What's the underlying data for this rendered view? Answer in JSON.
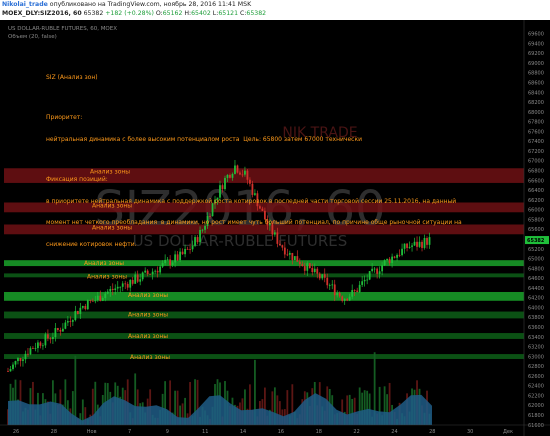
{
  "header": {
    "author": "Nikolai_trade",
    "published": "опубликовано на TradingView.com, ноябрь 28, 2016 11:41 MSK",
    "symbol": "MOEX_DLY:SIZ2016, 60",
    "last": "65382",
    "change": "+182 (+0.28%)",
    "ohlc_label_o": "O:",
    "ohlc_o": "65162",
    "ohlc_label_h": "H:",
    "ohlc_h": "65402",
    "ohlc_label_l": "L:",
    "ohlc_l": "65121",
    "ohlc_label_c": "C:",
    "ohlc_c": "65382"
  },
  "chart_header": {
    "title": "US DOLLAR-RUBLE FUTURES, 60, MOEX",
    "volume_label": "Объем (20, false)"
  },
  "watermark": {
    "big": "SIZ2016, 60",
    "sub": "US DOLLAR-RUBLE FUTURES",
    "author_mark": "NIK TRADE"
  },
  "annotation": {
    "heading": "SIZ (Анализ зон)",
    "priority_label": "Приоритет:",
    "priority_text": "нейтральная динамика с более высоким потенциалом роста  Цель: 65800 затем 67000 технически",
    "fix_label": "Фиксация позиций:",
    "fix_text_1": "в приоритете нейтральная динамика с поддержкой роста котировок в последней части торговой сессии 25.11.2016, на данный",
    "fix_text_2": "момент нет четкого преобладания  в динамики, но рост имеет чуть больший потенциал, по причине обще рыночной ситуации на",
    "fix_text_3": "снижение котировок нефти."
  },
  "colors": {
    "background": "#000000",
    "candle_up": "#1fbf3a",
    "candle_down": "#d0322b",
    "zone_red": "#6e1114",
    "zone_green": "#1aa32a",
    "zone_green_dark": "#0d5f17",
    "annotation_text": "#ff9a1a",
    "last_price_tag": "#1fbf3a",
    "volume_area": "#1f5c86"
  },
  "chart_data": {
    "type": "candlestick",
    "title": "US DOLLAR-RUBLE FUTURES, 60, MOEX",
    "ylim": [
      61600,
      69800
    ],
    "price_ticks": [
      69600,
      69400,
      69200,
      69000,
      68800,
      68600,
      68400,
      68200,
      68000,
      67800,
      67600,
      67400,
      67200,
      67000,
      66800,
      66600,
      66400,
      66200,
      66000,
      65800,
      65600,
      65400,
      65200,
      65000,
      64800,
      64600,
      64400,
      64200,
      64000,
      63800,
      63600,
      63400,
      63200,
      63000,
      62800,
      62600,
      62400,
      62200,
      62000,
      61800,
      61600
    ],
    "x_ticks": [
      "26",
      "28",
      "Нов",
      "7",
      "9",
      "11",
      "14",
      "16",
      "18",
      "22",
      "24",
      "28",
      "30",
      "Дек"
    ],
    "last_price": "65382",
    "zones": [
      {
        "label": "Анализ зоны",
        "low": 66550,
        "high": 66850,
        "kind": "resistance"
      },
      {
        "label": "Анализ зоны",
        "low": 65950,
        "high": 66150,
        "kind": "resistance"
      },
      {
        "label": "Анализ зоны",
        "low": 65500,
        "high": 65700,
        "kind": "resistance"
      },
      {
        "label": "Анализ зоны",
        "low": 64850,
        "high": 64970,
        "kind": "support"
      },
      {
        "label": "Анализ зоны",
        "low": 64620,
        "high": 64700,
        "kind": "support"
      },
      {
        "label": "Анализ зоны",
        "low": 64140,
        "high": 64320,
        "kind": "support"
      },
      {
        "label": "Анализ зоны",
        "low": 63780,
        "high": 63920,
        "kind": "support"
      },
      {
        "label": "Анализ зоны",
        "low": 63360,
        "high": 63480,
        "kind": "support"
      },
      {
        "label": "Анализ зоны",
        "low": 62950,
        "high": 63050,
        "kind": "support"
      }
    ],
    "close_path": [
      62700,
      62950,
      63150,
      63300,
      63420,
      63600,
      63850,
      64050,
      64150,
      64300,
      64400,
      64500,
      64600,
      64700,
      64820,
      64950,
      65050,
      65250,
      65600,
      66150,
      66600,
      66900,
      66700,
      66200,
      65700,
      65350,
      65100,
      64950,
      64750,
      64600,
      64400,
      64200,
      64300,
      64550,
      64750,
      64950,
      65100,
      65250,
      65300,
      65382
    ]
  }
}
